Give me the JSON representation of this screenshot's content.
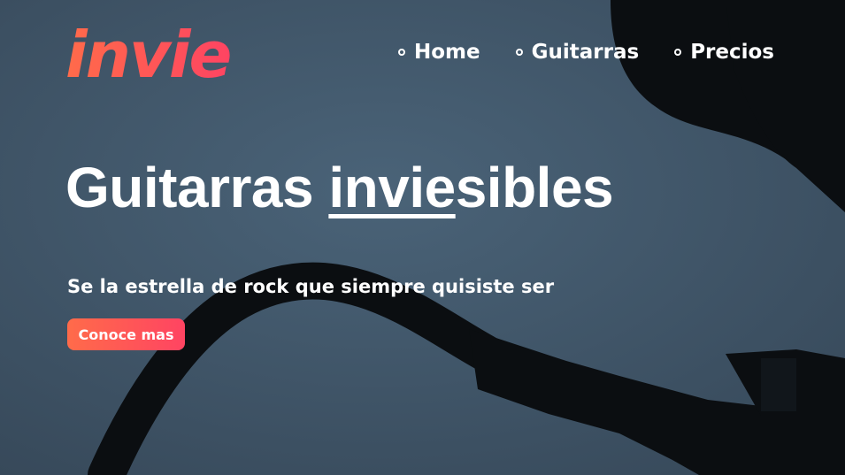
{
  "brand": {
    "logo_text": "invie",
    "accent_start": "#ff6b4a",
    "accent_end": "#ff4462"
  },
  "nav": {
    "items": [
      {
        "label": "Home",
        "icon": "circle-bullet-icon"
      },
      {
        "label": "Guitarras",
        "icon": "circle-bullet-icon"
      },
      {
        "label": "Precios",
        "icon": "circle-bullet-icon"
      }
    ]
  },
  "hero": {
    "headline_before": "Guitarras ",
    "headline_accent": "invie",
    "headline_after": "sibles",
    "subtitle": "Se la estrella de rock que siempre quisiste ser",
    "cta_label": "Conoce mas",
    "background_color": "#435b70",
    "silhouette_color": "#0b0e11"
  }
}
